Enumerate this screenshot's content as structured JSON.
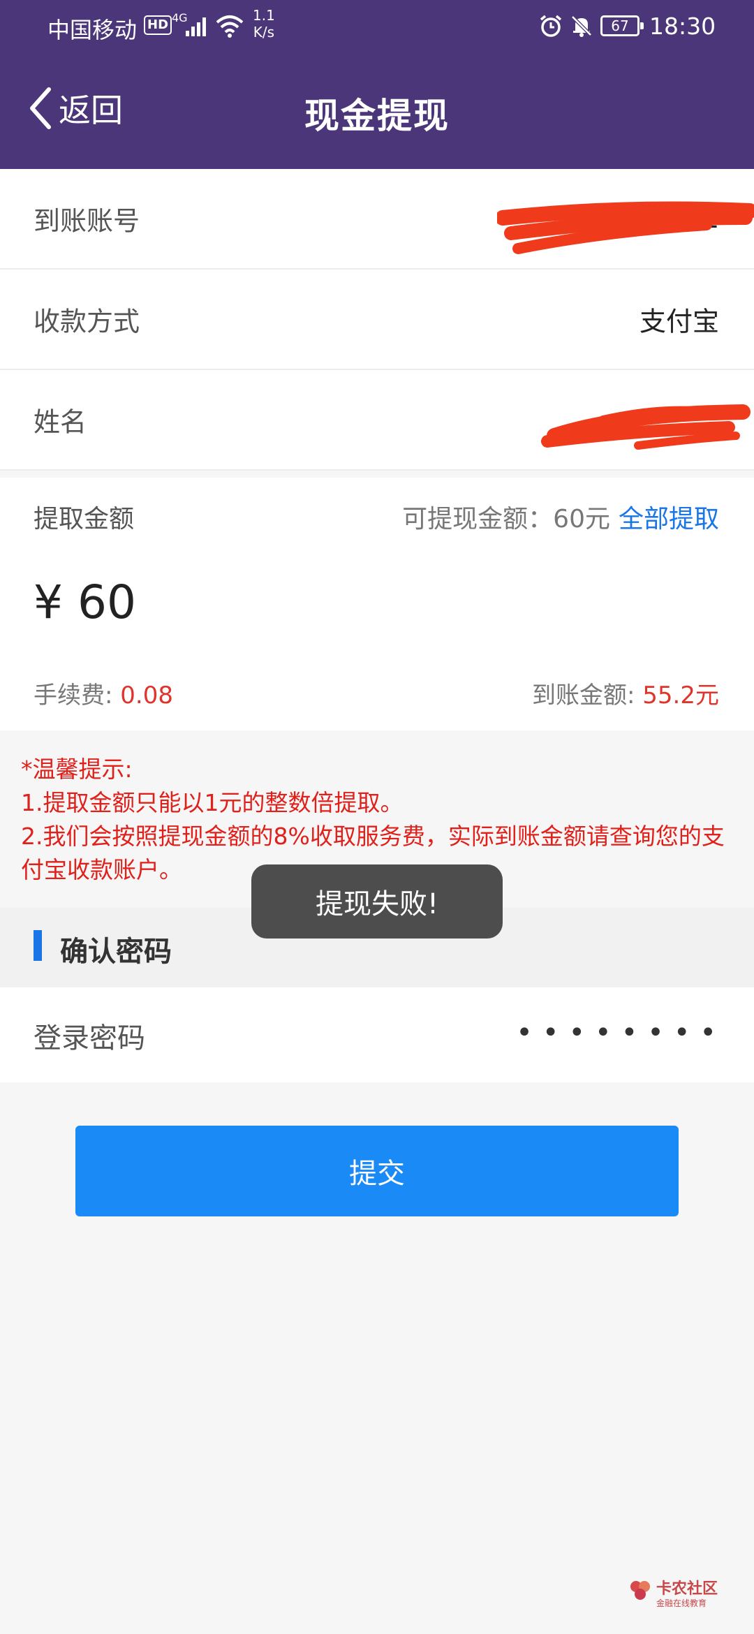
{
  "statusbar": {
    "carrier": "中国移动",
    "hd": "HD",
    "network": "4G",
    "speed_value": "1.1",
    "speed_unit": "K/s",
    "battery": "67",
    "time": "18:30"
  },
  "navbar": {
    "back_label": "返回",
    "title": "现金提现"
  },
  "form": {
    "account_label": "到账账号",
    "account_value": "1",
    "method_label": "收款方式",
    "method_value": "支付宝",
    "name_label": "姓名",
    "name_value": ""
  },
  "amount": {
    "label": "提取金额",
    "available_text": "可提现金额：60元",
    "withdraw_all": "全部提取",
    "input_value": "¥ 60",
    "fee_label": "手续费: ",
    "fee_value": "0.08",
    "arrive_label": "到账金额: ",
    "arrive_value": "55.2元"
  },
  "tips": {
    "title": "*温馨提示:",
    "line1": "1.提取金额只能以1元的整数倍提取。",
    "line2": "2.我们会按照提现金额的8%收取服务费，实际到账金额请查询您的支付宝收款账户。"
  },
  "password": {
    "section_title": "确认密码",
    "label": "登录密码",
    "masked": "••••••••"
  },
  "submit_label": "提交",
  "toast": "提现失败!",
  "watermark": {
    "main": "卡农社区",
    "sub": "金融在线教育"
  },
  "colors": {
    "header": "#4a3678",
    "accent": "#1a76e6",
    "button": "#1a8af7",
    "warning": "#e0201a"
  }
}
